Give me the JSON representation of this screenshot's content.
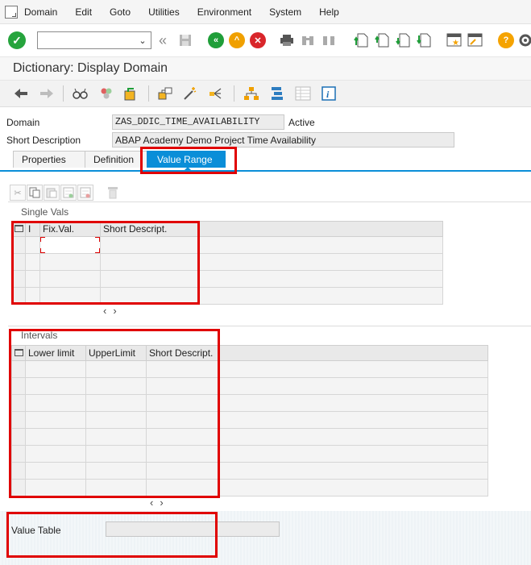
{
  "menu": {
    "items": [
      "Domain",
      "Edit",
      "Goto",
      "Utilities",
      "Environment",
      "System",
      "Help"
    ]
  },
  "toolbar": {
    "command_field_value": ""
  },
  "title": "Dictionary: Display Domain",
  "header": {
    "domain_label": "Domain",
    "domain_value": "ZAS_DDIC_TIME_AVAILABILITY",
    "status": "Active",
    "short_desc_label": "Short Description",
    "short_desc_value": "ABAP Academy Demo Project Time Availability"
  },
  "tabs": [
    {
      "label": "Properties"
    },
    {
      "label": "Definition"
    },
    {
      "label": "Value Range"
    }
  ],
  "single_vals": {
    "title": "Single Vals",
    "columns": [
      "I",
      "Fix.Val.",
      "Short Descript."
    ]
  },
  "intervals": {
    "title": "Intervals",
    "columns": [
      "Lower limit",
      "UpperLimit",
      "Short Descript."
    ]
  },
  "value_table": {
    "label": "Value Table",
    "value": ""
  },
  "colors": {
    "accent": "#0a8ed8",
    "highlight": "#e00000",
    "ok_green": "#26a43d",
    "back_green": "#1f9e39",
    "exit_orange": "#f0a000",
    "cancel_red": "#d9262b",
    "help_orange": "#f5a300"
  }
}
